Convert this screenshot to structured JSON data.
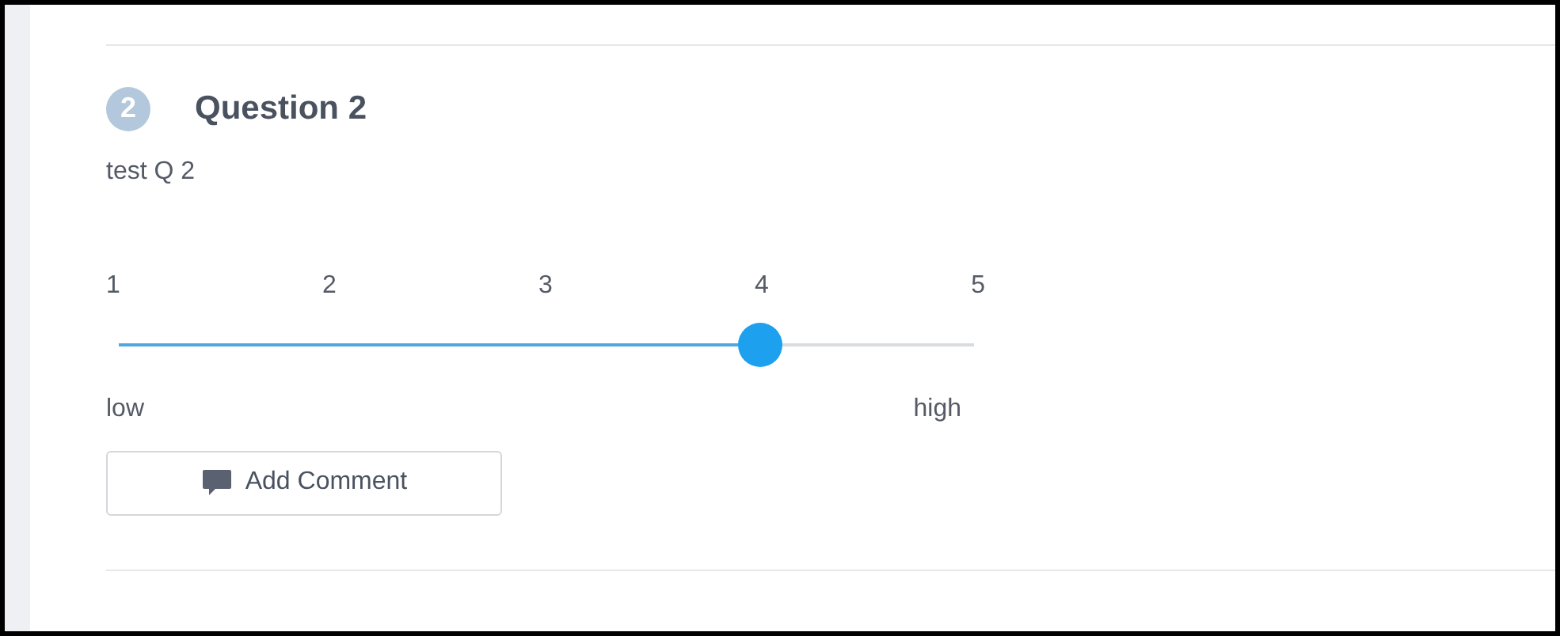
{
  "question": {
    "number": "2",
    "title": "Question 2",
    "text": "test Q 2"
  },
  "scale": {
    "ticks": [
      "1",
      "2",
      "3",
      "4",
      "5"
    ],
    "level": 0.75,
    "low_label": "low",
    "high_label": "high"
  },
  "comment_button": {
    "label": "Add Comment"
  }
}
